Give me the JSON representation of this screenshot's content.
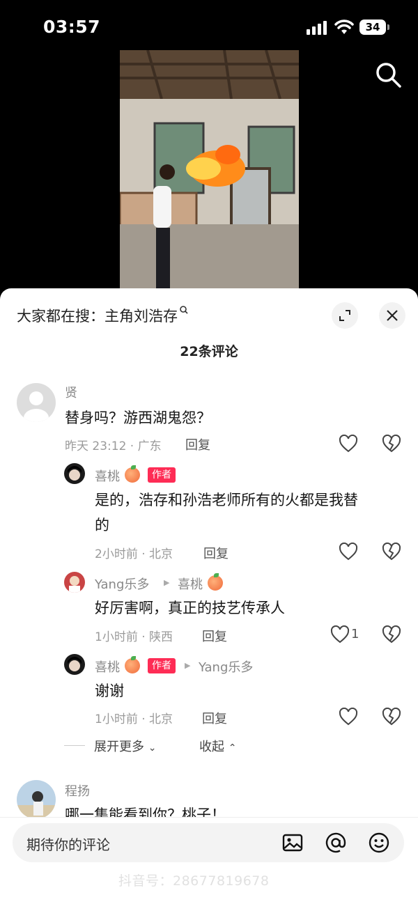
{
  "status_bar": {
    "time": "03:57",
    "battery": "34"
  },
  "search_prompt": {
    "prefix": "大家都在搜：",
    "term": "主角刘浩存"
  },
  "comment_count": "22条评论",
  "comments": [
    {
      "user": "贤",
      "text": "替身吗？游西湖鬼怨？",
      "meta": "昨天 23:12 · 广东",
      "reply": "回复"
    },
    {
      "user": "喜桃",
      "badge": "作者",
      "text_line1": "是的，浩存和孙浩老师所有的火都是我替",
      "text_line2": "的",
      "meta": "2小时前 · 北京",
      "reply": "回复"
    },
    {
      "user": "Yang乐多",
      "reply_to": "喜桃",
      "text": "好厉害啊，真正的技艺传承人",
      "meta": "1小时前 · 陕西",
      "reply": "回复",
      "likes": "1"
    },
    {
      "user": "喜桃",
      "badge": "作者",
      "reply_to": "Yang乐多",
      "text": "谢谢",
      "meta": "1小时前 · 北京",
      "reply": "回复"
    },
    {
      "user": "程扬",
      "text": "哪一集能看到你？桃子！"
    }
  ],
  "thread_controls": {
    "expand_more": "展开更多",
    "collapse": "收起"
  },
  "input": {
    "placeholder": "期待你的评论"
  },
  "watermark": "抖音号：28677819678",
  "colors": {
    "accent": "#fe2c55",
    "sheet": "#ffffff",
    "background": "#000000"
  }
}
